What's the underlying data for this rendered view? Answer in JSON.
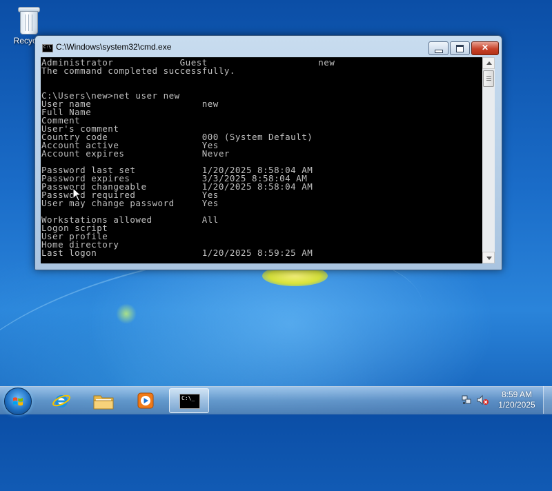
{
  "desktop": {
    "icons": [
      {
        "label": "Recycle",
        "icon": "recycle-bin-icon"
      }
    ]
  },
  "cmd_window": {
    "title": "C:\\Windows\\system32\\cmd.exe",
    "lines": [
      "Administrator            Guest                    new",
      "The command completed successfully.",
      "",
      "",
      "C:\\Users\\new>net user new",
      "User name                    new",
      "Full Name",
      "Comment",
      "User's comment",
      "Country code                 000 (System Default)",
      "Account active               Yes",
      "Account expires              Never",
      "",
      "Password last set            1/20/2025 8:58:04 AM",
      "Password expires             3/3/2025 8:58:04 AM",
      "Password changeable          1/20/2025 8:58:04 AM",
      "Password required            Yes",
      "User may change password     Yes",
      "",
      "Workstations allowed         All",
      "Logon script",
      "User profile",
      "Home directory",
      "Last logon                   1/20/2025 8:59:25 AM"
    ],
    "colors": {
      "background": "#000000",
      "text": "#c0c0c0"
    }
  },
  "taskbar": {
    "apps": [
      {
        "name": "internet-explorer",
        "icon": "internet-explorer-icon"
      },
      {
        "name": "windows-explorer",
        "icon": "folder-icon"
      },
      {
        "name": "windows-media-player",
        "icon": "media-player-icon"
      },
      {
        "name": "command-prompt",
        "icon": "command-prompt-icon",
        "active": true
      }
    ],
    "clock": {
      "time": "8:59 AM",
      "date": "1/20/2025"
    }
  }
}
